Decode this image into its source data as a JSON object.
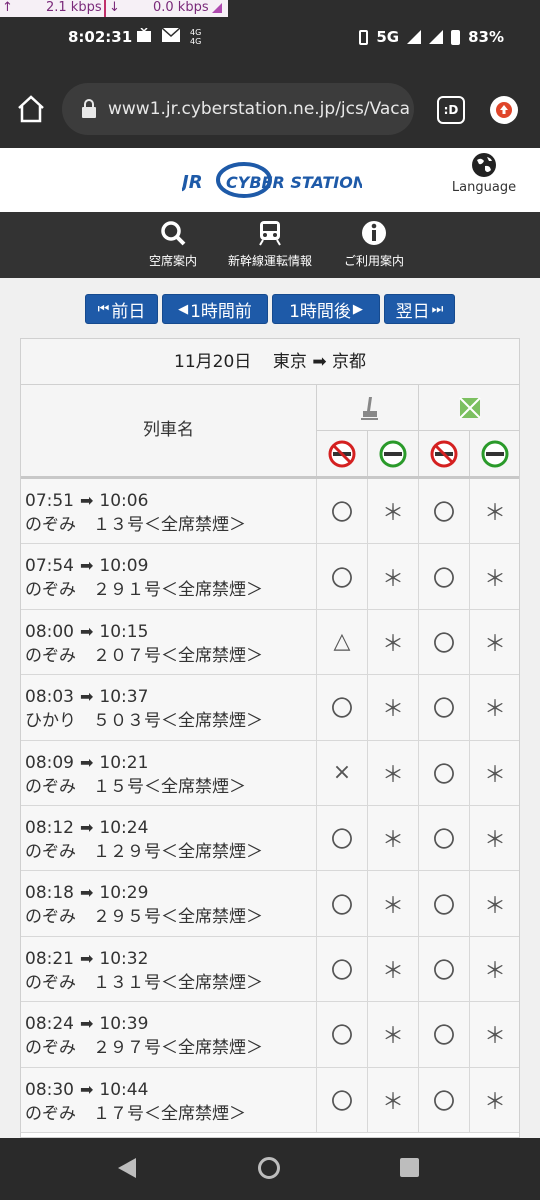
{
  "status_bar": {
    "upload_arrow": "↑",
    "upload": "2.1 kbps",
    "download_arrow": "↓",
    "download": "0.0 kbps",
    "time": "8:02:31",
    "network": "5G",
    "battery": "83%"
  },
  "browser": {
    "url": "www1.jr.cyberstation.ne.jp/jcs/Vaca",
    "tab_label": ":D"
  },
  "site": {
    "logo_jr": "JR",
    "logo_text": "CYBER STATION",
    "language_label": "Language"
  },
  "nav": {
    "items": [
      {
        "label": "空席案内"
      },
      {
        "label": "新幹線運転情報"
      },
      {
        "label": "ご利用案内"
      }
    ]
  },
  "pager": {
    "prev_day": "前日",
    "prev_hour": "1時間前",
    "next_hour": "1時間後",
    "next_day": "翌日"
  },
  "table": {
    "date": "11月20日",
    "from": "東京",
    "to": "京都",
    "arrow": "➡",
    "train_name_header": "列車名",
    "rows": [
      {
        "dep": "07:51",
        "arr": "10:06",
        "name": "のぞみ　１３号＜全席禁煙＞",
        "s1": "〇",
        "s2": "＊",
        "s3": "〇",
        "s4": "＊"
      },
      {
        "dep": "07:54",
        "arr": "10:09",
        "name": "のぞみ　２９１号＜全席禁煙＞",
        "s1": "〇",
        "s2": "＊",
        "s3": "〇",
        "s4": "＊"
      },
      {
        "dep": "08:00",
        "arr": "10:15",
        "name": "のぞみ　２０７号＜全席禁煙＞",
        "s1": "△",
        "s2": "＊",
        "s3": "〇",
        "s4": "＊"
      },
      {
        "dep": "08:03",
        "arr": "10:37",
        "name": "ひかり　５０３号＜全席禁煙＞",
        "s1": "〇",
        "s2": "＊",
        "s3": "〇",
        "s4": "＊"
      },
      {
        "dep": "08:09",
        "arr": "10:21",
        "name": "のぞみ　１５号＜全席禁煙＞",
        "s1": "×",
        "s2": "＊",
        "s3": "〇",
        "s4": "＊"
      },
      {
        "dep": "08:12",
        "arr": "10:24",
        "name": "のぞみ　１２９号＜全席禁煙＞",
        "s1": "〇",
        "s2": "＊",
        "s3": "〇",
        "s4": "＊"
      },
      {
        "dep": "08:18",
        "arr": "10:29",
        "name": "のぞみ　２９５号＜全席禁煙＞",
        "s1": "〇",
        "s2": "＊",
        "s3": "〇",
        "s4": "＊"
      },
      {
        "dep": "08:21",
        "arr": "10:32",
        "name": "のぞみ　１３１号＜全席禁煙＞",
        "s1": "〇",
        "s2": "＊",
        "s3": "〇",
        "s4": "＊"
      },
      {
        "dep": "08:24",
        "arr": "10:39",
        "name": "のぞみ　２９７号＜全席禁煙＞",
        "s1": "〇",
        "s2": "＊",
        "s3": "〇",
        "s4": "＊"
      },
      {
        "dep": "08:30",
        "arr": "10:44",
        "name": "のぞみ　１７号＜全席禁煙＞",
        "s1": "〇",
        "s2": "＊",
        "s3": "〇",
        "s4": "＊"
      }
    ]
  },
  "colors": {
    "pager_blue": "#1e5aa8",
    "no_smoking_red": "#d42020",
    "smoking_green": "#2a9a2a",
    "logo_blue": "#1e5aa8"
  }
}
